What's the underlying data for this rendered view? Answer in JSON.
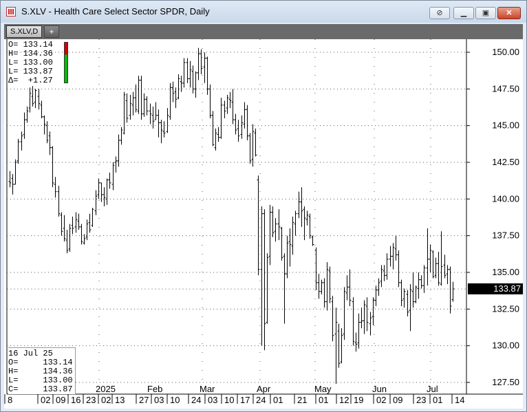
{
  "window": {
    "title": "S.XLV - Health Care Select Sector SPDR, Daily",
    "controls": {
      "link": "link-icon",
      "minimize": "minimize-icon",
      "maximize": "maximize-icon",
      "close": "close-icon"
    }
  },
  "tabs": [
    {
      "label": "S.XLV,D"
    },
    {
      "label": "+"
    }
  ],
  "ohlc_panel": {
    "open": "O= 133.14",
    "high": "H= 134.36",
    "low": "L= 133.00",
    "close": "L= 133.87",
    "change": "Δ=  +1.27"
  },
  "info_box": {
    "date": "16 Jul 25",
    "open": "O=     133.14",
    "high": "H=     134.36",
    "low": "L=     133.00",
    "close": "C=     133.87"
  },
  "last_price": "133.87",
  "colors": {
    "up": "#00bb00",
    "down": "#d00000",
    "bars": "#000000",
    "last_price_bg": "#000000"
  },
  "chart_data": {
    "type": "ohlc-bar",
    "title": "S.XLV - Health Care Select Sector SPDR, Daily",
    "ylim": [
      127.0,
      152.0
    ],
    "y_ticks": [
      "150.00",
      "147.50",
      "145.00",
      "142.50",
      "140.00",
      "137.50",
      "135.00",
      "132.50",
      "130.00",
      "127.50"
    ],
    "grid": true,
    "x_tick_labels": [
      "8",
      "02",
      "09",
      "16",
      "23",
      "02",
      "13",
      "27",
      "03",
      "10",
      "24",
      "03",
      "10",
      "17",
      "24",
      "01",
      "21",
      "01",
      "12",
      "19",
      "02",
      "09",
      "23",
      "01",
      "14"
    ],
    "x_month_labels": [
      "2025",
      "Feb",
      "Mar",
      "Apr",
      "May",
      "Jun",
      "Jul"
    ],
    "last": 133.87,
    "bars": [
      [
        141.2,
        141.9,
        140.8,
        141.1
      ],
      [
        141.4,
        141.7,
        140.3,
        141.0
      ],
      [
        141.0,
        142.7,
        141.0,
        142.5
      ],
      [
        142.6,
        144.1,
        142.4,
        143.9
      ],
      [
        143.9,
        144.6,
        143.3,
        144.3
      ],
      [
        144.4,
        145.9,
        144.1,
        145.4
      ],
      [
        145.4,
        146.3,
        145.2,
        146.0
      ],
      [
        146.2,
        147.6,
        145.9,
        147.2
      ],
      [
        147.0,
        147.7,
        146.3,
        146.5
      ],
      [
        146.6,
        147.5,
        146.2,
        147.4
      ],
      [
        147.0,
        147.5,
        146.1,
        146.5
      ],
      [
        146.4,
        146.7,
        145.5,
        145.6
      ],
      [
        145.6,
        145.7,
        144.4,
        145.1
      ],
      [
        145.0,
        145.3,
        143.8,
        144.0
      ],
      [
        144.3,
        144.6,
        143.0,
        143.5
      ],
      [
        143.5,
        143.6,
        140.8,
        141.1
      ],
      [
        141.0,
        141.5,
        140.1,
        140.5
      ],
      [
        140.5,
        140.9,
        138.8,
        139.0
      ],
      [
        138.9,
        139.1,
        137.5,
        137.8
      ],
      [
        138.0,
        138.9,
        137.1,
        137.3
      ],
      [
        137.2,
        137.9,
        136.3,
        136.5
      ],
      [
        136.6,
        138.3,
        136.4,
        138.0
      ],
      [
        138.2,
        138.8,
        137.6,
        138.0
      ],
      [
        138.1,
        139.1,
        137.7,
        138.6
      ],
      [
        138.5,
        139.0,
        137.9,
        138.1
      ],
      [
        138.1,
        138.3,
        136.9,
        137.1
      ],
      [
        137.0,
        137.6,
        136.9,
        137.3
      ],
      [
        137.4,
        138.6,
        137.2,
        138.3
      ],
      [
        138.4,
        139.0,
        137.7,
        137.9
      ],
      [
        138.2,
        139.4,
        138.1,
        139.3
      ],
      [
        139.2,
        140.6,
        138.9,
        140.2
      ],
      [
        140.3,
        141.4,
        140.0,
        141.1
      ],
      [
        141.1,
        141.1,
        139.8,
        140.3
      ],
      [
        140.3,
        140.8,
        139.5,
        140.1
      ],
      [
        140.0,
        141.4,
        139.6,
        141.3
      ],
      [
        141.3,
        141.8,
        140.7,
        141.1
      ],
      [
        141.0,
        142.5,
        140.6,
        142.3
      ],
      [
        142.5,
        142.9,
        141.8,
        142.6
      ],
      [
        142.6,
        144.4,
        142.2,
        144.0
      ],
      [
        144.0,
        144.9,
        143.7,
        144.7
      ],
      [
        144.5,
        147.3,
        144.4,
        147.1
      ],
      [
        146.7,
        147.2,
        145.2,
        145.5
      ],
      [
        145.7,
        147.1,
        145.4,
        146.5
      ],
      [
        146.4,
        147.3,
        145.7,
        146.9
      ],
      [
        146.9,
        147.8,
        145.9,
        146.1
      ],
      [
        146.0,
        148.4,
        145.8,
        148.1
      ],
      [
        148.1,
        148.4,
        145.4,
        145.8
      ],
      [
        145.8,
        147.2,
        145.6,
        146.8
      ],
      [
        146.8,
        147.0,
        145.7,
        146.0
      ],
      [
        146.0,
        146.5,
        145.1,
        145.8
      ],
      [
        145.7,
        146.3,
        144.8,
        145.3
      ],
      [
        145.4,
        146.6,
        145.4,
        145.7
      ],
      [
        145.7,
        146.1,
        144.2,
        145.2
      ],
      [
        145.2,
        145.4,
        143.8,
        144.7
      ],
      [
        144.6,
        145.3,
        144.2,
        144.5
      ],
      [
        144.6,
        146.2,
        144.5,
        145.7
      ],
      [
        145.6,
        147.9,
        145.4,
        147.6
      ],
      [
        147.6,
        148.0,
        146.6,
        147.2
      ],
      [
        147.3,
        147.6,
        146.2,
        146.8
      ],
      [
        146.9,
        148.5,
        146.8,
        148.2
      ],
      [
        148.0,
        148.4,
        147.3,
        147.9
      ],
      [
        147.9,
        149.6,
        147.6,
        149.3
      ],
      [
        149.3,
        149.6,
        147.9,
        148.2
      ],
      [
        148.2,
        149.4,
        147.6,
        148.8
      ],
      [
        148.7,
        149.1,
        147.2,
        147.5
      ],
      [
        147.5,
        148.7,
        146.9,
        148.6
      ],
      [
        148.6,
        150.3,
        148.1,
        149.9
      ],
      [
        149.9,
        150.2,
        148.5,
        148.9
      ],
      [
        149.0,
        150.0,
        147.9,
        149.6
      ],
      [
        149.6,
        149.7,
        147.1,
        147.5
      ],
      [
        147.5,
        147.8,
        145.5,
        145.7
      ],
      [
        145.7,
        146.0,
        143.6,
        143.7
      ],
      [
        143.5,
        144.8,
        143.3,
        144.5
      ],
      [
        144.4,
        144.9,
        143.9,
        144.2
      ],
      [
        144.2,
        146.9,
        144.1,
        146.4
      ],
      [
        146.4,
        146.7,
        145.5,
        146.0
      ],
      [
        146.2,
        147.1,
        145.8,
        146.9
      ],
      [
        146.8,
        147.3,
        146.2,
        146.7
      ],
      [
        146.6,
        147.5,
        145.1,
        145.4
      ],
      [
        145.4,
        145.8,
        144.4,
        144.7
      ],
      [
        144.8,
        145.4,
        143.9,
        144.3
      ],
      [
        144.4,
        145.7,
        144.1,
        145.2
      ],
      [
        145.1,
        146.6,
        144.8,
        146.1
      ],
      [
        146.1,
        146.4,
        144.0,
        144.3
      ],
      [
        144.3,
        144.5,
        142.4,
        142.6
      ],
      [
        142.7,
        145.1,
        142.2,
        144.6
      ],
      [
        144.5,
        144.8,
        142.9,
        143.0
      ],
      [
        141.3,
        141.6,
        134.8,
        135.2
      ],
      [
        135.2,
        139.5,
        130.0,
        139.0
      ],
      [
        139.0,
        139.3,
        129.7,
        131.5
      ],
      [
        131.6,
        136.3,
        131.5,
        136.0
      ],
      [
        136.1,
        139.6,
        135.5,
        139.1
      ],
      [
        139.1,
        139.5,
        137.4,
        137.7
      ],
      [
        137.8,
        138.7,
        137.1,
        138.3
      ],
      [
        138.3,
        139.3,
        137.2,
        138.1
      ],
      [
        138.0,
        138.1,
        135.8,
        136.0
      ],
      [
        136.1,
        136.3,
        131.5,
        134.9
      ],
      [
        134.9,
        137.5,
        134.6,
        137.0
      ],
      [
        137.1,
        138.0,
        135.4,
        136.9
      ],
      [
        136.8,
        138.8,
        136.2,
        138.4
      ],
      [
        138.3,
        139.2,
        137.5,
        139.0
      ],
      [
        139.0,
        140.5,
        138.7,
        139.8
      ],
      [
        139.8,
        140.8,
        138.1,
        139.2
      ],
      [
        139.3,
        139.5,
        137.2,
        138.7
      ],
      [
        138.6,
        139.2,
        138.2,
        138.9
      ],
      [
        138.8,
        139.0,
        137.3,
        137.5
      ],
      [
        137.4,
        137.5,
        136.8,
        136.9
      ],
      [
        136.5,
        136.7,
        133.8,
        134.3
      ],
      [
        134.3,
        134.9,
        133.2,
        133.7
      ],
      [
        133.7,
        134.5,
        133.5,
        134.3
      ],
      [
        134.3,
        134.6,
        132.6,
        133.0
      ],
      [
        133.0,
        135.7,
        132.4,
        135.2
      ],
      [
        135.1,
        135.4,
        132.9,
        133.2
      ],
      [
        133.0,
        133.4,
        130.3,
        130.7
      ],
      [
        130.8,
        132.6,
        127.4,
        131.6
      ],
      [
        131.0,
        131.5,
        128.5,
        128.8
      ],
      [
        128.9,
        131.2,
        128.8,
        130.7
      ],
      [
        130.8,
        134.0,
        130.4,
        133.7
      ],
      [
        133.6,
        134.8,
        133.1,
        134.0
      ],
      [
        134.0,
        135.2,
        132.7,
        133.1
      ],
      [
        133.0,
        133.3,
        130.0,
        130.3
      ],
      [
        130.2,
        130.9,
        129.6,
        130.1
      ],
      [
        130.2,
        132.2,
        129.8,
        131.6
      ],
      [
        131.6,
        132.6,
        131.2,
        131.7
      ],
      [
        131.7,
        133.1,
        130.8,
        132.8
      ],
      [
        132.7,
        133.3,
        131.0,
        131.6
      ],
      [
        131.5,
        132.3,
        130.7,
        131.9
      ],
      [
        132.0,
        133.3,
        131.4,
        133.1
      ],
      [
        133.1,
        134.1,
        132.7,
        133.8
      ],
      [
        133.8,
        134.6,
        133.4,
        134.3
      ],
      [
        134.4,
        135.5,
        134.0,
        135.2
      ],
      [
        135.1,
        135.5,
        134.4,
        134.8
      ],
      [
        134.8,
        136.3,
        134.5,
        135.9
      ],
      [
        135.9,
        136.8,
        135.4,
        136.1
      ],
      [
        136.1,
        137.0,
        135.2,
        136.7
      ],
      [
        136.6,
        137.5,
        135.8,
        136.2
      ],
      [
        136.2,
        136.5,
        134.0,
        134.3
      ],
      [
        134.3,
        134.5,
        132.7,
        133.1
      ],
      [
        133.2,
        133.9,
        132.6,
        133.7
      ],
      [
        133.5,
        133.8,
        132.0,
        132.3
      ],
      [
        132.4,
        134.2,
        131.0,
        133.8
      ],
      [
        133.7,
        135.0,
        132.6,
        133.0
      ],
      [
        133.0,
        134.1,
        132.9,
        134.0
      ],
      [
        133.9,
        135.0,
        133.2,
        134.5
      ],
      [
        134.5,
        134.8,
        133.9,
        134.1
      ],
      [
        134.1,
        135.5,
        133.6,
        135.3
      ],
      [
        135.3,
        138.0,
        134.1,
        135.9
      ],
      [
        135.9,
        136.9,
        135.0,
        136.5
      ],
      [
        136.4,
        136.5,
        134.6,
        134.7
      ],
      [
        134.8,
        136.0,
        134.6,
        135.6
      ],
      [
        135.6,
        136.4,
        134.1,
        134.3
      ],
      [
        134.2,
        137.8,
        134.1,
        135.4
      ],
      [
        135.5,
        136.2,
        134.6,
        134.8
      ],
      [
        134.9,
        135.5,
        134.2,
        135.2
      ],
      [
        135.2,
        135.4,
        132.2,
        132.7
      ],
      [
        133.14,
        134.36,
        133.0,
        133.87
      ]
    ]
  }
}
